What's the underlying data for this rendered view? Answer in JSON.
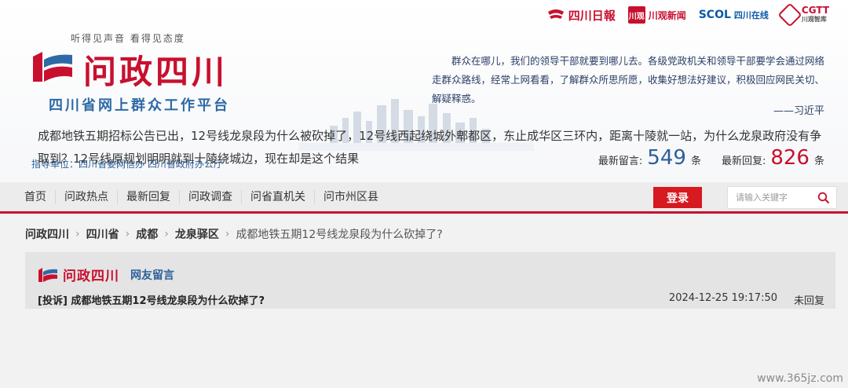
{
  "partners": {
    "sichuan_daily": "四川日報",
    "chuanguan_box": "川观",
    "chuanguan": "川观新闻",
    "scol": "SCOL",
    "scol_sub": "四川在线",
    "cgtt": "CGTT",
    "cgtt_sub": "川观智库"
  },
  "header": {
    "slogan": "听得见声音  看得见态度",
    "title": "问政四川",
    "subtitle": "四川省网上群众工作平台",
    "quote": "群众在哪儿，我们的领导干部就要到哪儿去。各级党政机关和领导干部要学会通过网络走群众路线，经常上网看看，了解群众所思所愿，收集好想法好建议，积极回应网民关切、解疑释惑。",
    "quote_author": "——习近平",
    "guide": "指导单位：四川省委网信办  四川省政府办公厅",
    "latest_msg_label": "最新留言:",
    "latest_msg_count": "549",
    "latest_msg_unit": "条",
    "latest_reply_label": "最新回复:",
    "latest_reply_count": "826",
    "latest_reply_unit": "条"
  },
  "nav": {
    "items": [
      "首页",
      "问政热点",
      "最新回复",
      "问政调查",
      "问省直机关",
      "问市州区县"
    ],
    "login": "登录",
    "search_placeholder": "请输入关键字"
  },
  "breadcrumb": [
    "问政四川",
    "四川省",
    "成都",
    "龙泉驿区",
    "成都地铁五期12号线龙泉段为什么砍掉了?"
  ],
  "post": {
    "logo_text": "问政四川",
    "tag": "网友留言",
    "title": "[投诉] 成都地铁五期12号线龙泉段为什么砍掉了?",
    "date": "2024-12-25 19:17:50",
    "status": "未回复",
    "body": "成都地铁五期招标公告已出，12号线龙泉段为什么被砍掉了，12号线西起绕城外郫都区，东止成华区三环内，距离十陵就一站，为什么龙泉政府没有争取到？12号线原规划明明就到十陵绕城边，现在却是这个结果"
  },
  "watermark": "www.365jz.com",
  "colors": {
    "brand_red": "#c8102e",
    "brand_blue": "#2d5f9a"
  }
}
